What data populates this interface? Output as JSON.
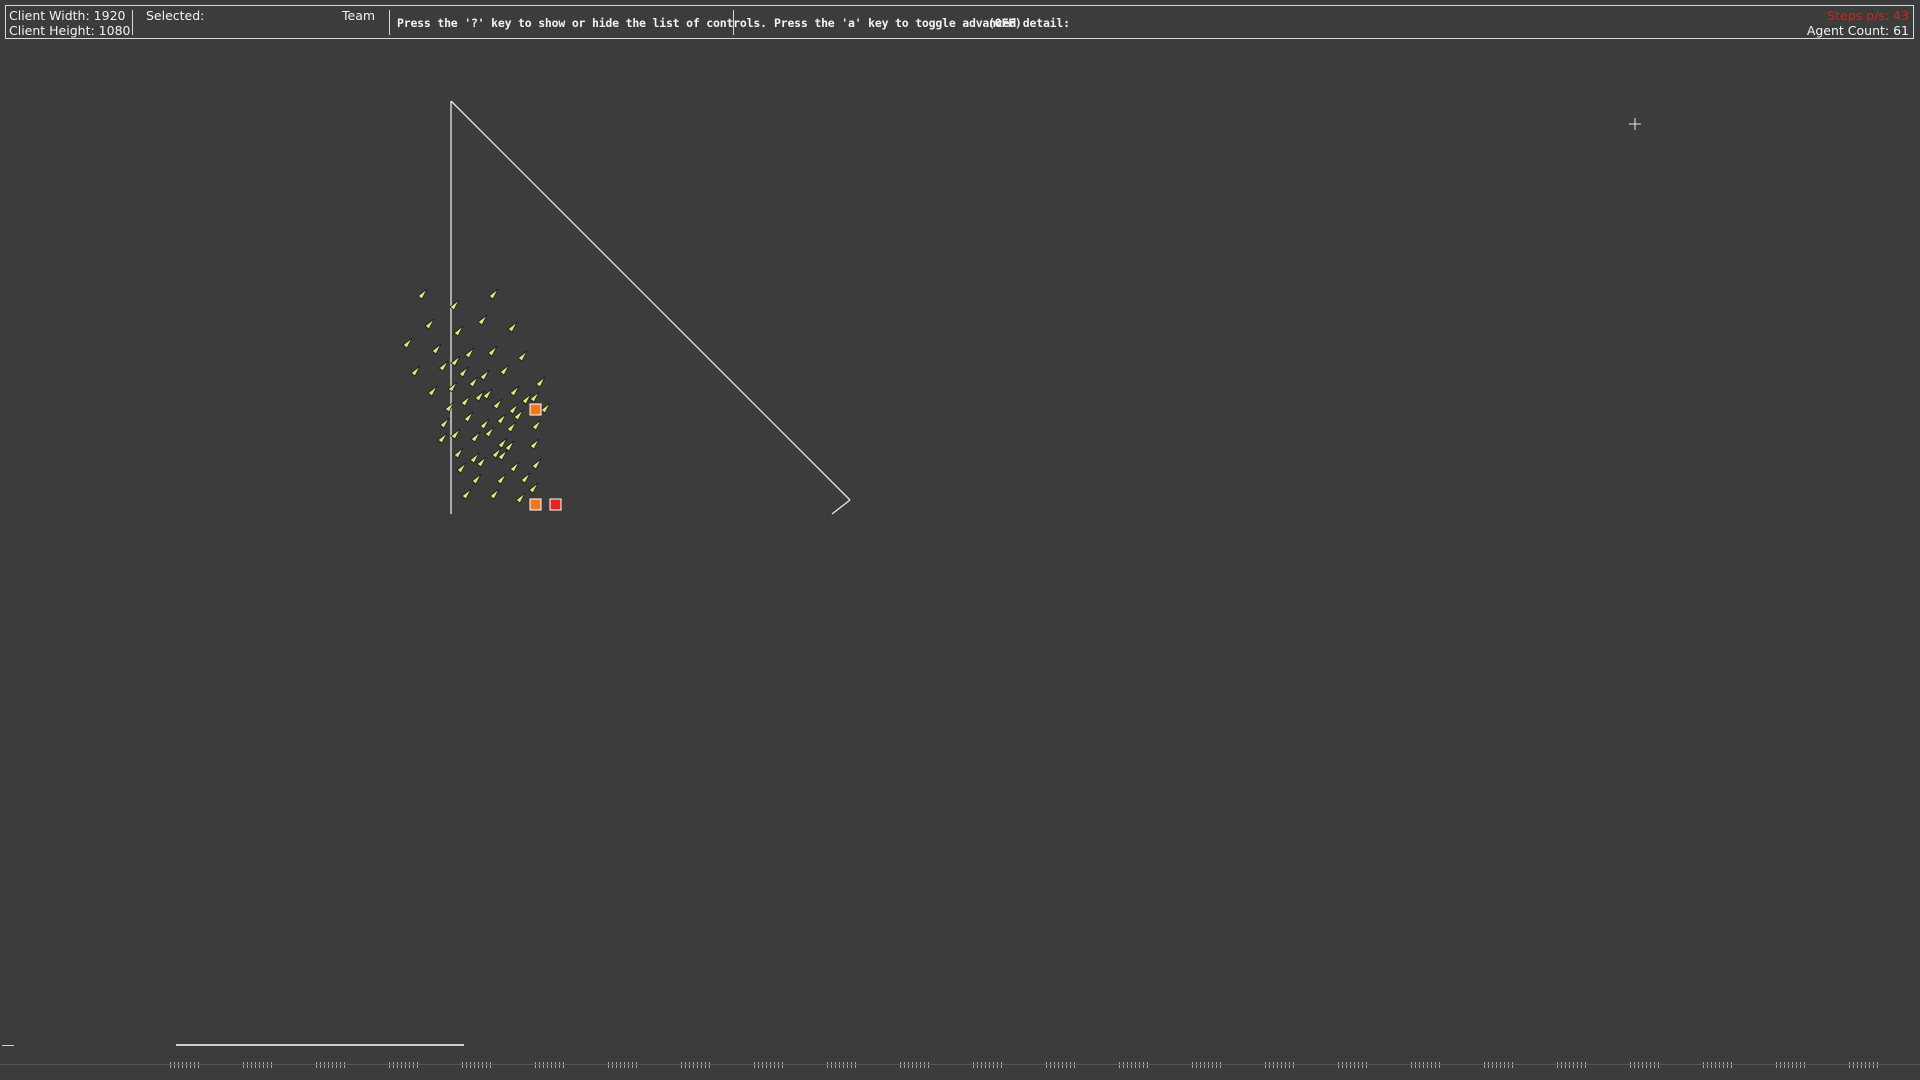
{
  "hud": {
    "client_width_label": "Client Width: 1920",
    "client_height_label": "Client Height: 1080",
    "selected_label": "Selected:",
    "team_label": "Team",
    "controls_hint": "Press the '?' key to show or hide the list of controls.",
    "advanced_hint": "Press the 'a' key to toggle advanced detail:",
    "advanced_state": "(OFF)",
    "steps_label": "Steps p/s: 43",
    "agent_count_label": "Agent Count: 61"
  },
  "world": {
    "boundary_color": "#e8e8e8",
    "agent_color": "#e3e37a",
    "target_colors": [
      "#f07820",
      "#f07820",
      "#e82020"
    ]
  },
  "icons": {
    "cursor": "crosshair-cursor-icon"
  }
}
